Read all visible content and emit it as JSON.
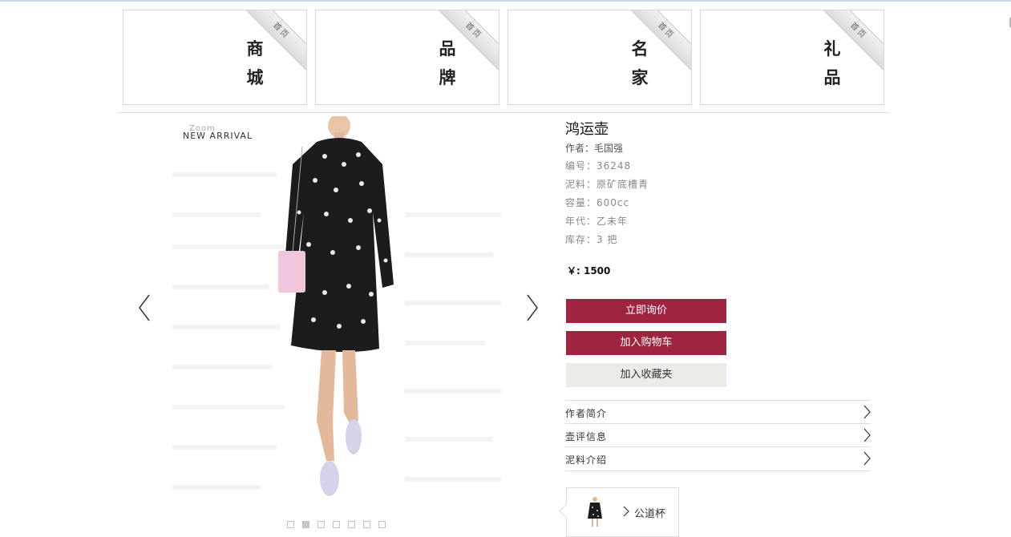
{
  "categories": [
    {
      "line1": "商",
      "line2": "城",
      "ribbon": "首页"
    },
    {
      "line1": "品",
      "line2": "牌",
      "ribbon": "首页"
    },
    {
      "line1": "名",
      "line2": "家",
      "ribbon": "首页"
    },
    {
      "line1": "礼",
      "line2": "品",
      "ribbon": "首页"
    }
  ],
  "gallery": {
    "zoom_text": "Zoom",
    "new_arrival": "NEW ARRIVAL",
    "slide_count": 7,
    "active_slide": 2,
    "prev_icon": "chevron-left-icon",
    "next_icon": "chevron-right-icon"
  },
  "product": {
    "title": "鸿运壶",
    "author": "作者：毛国强",
    "code": "编号：36248",
    "clay": "泥料：原矿底槽青",
    "capacity": "容量：600cc",
    "era": "年代：乙未年",
    "stock": "库存：3 把",
    "price": "￥: 1500"
  },
  "actions": {
    "inquire": "立即询价",
    "add_cart": "加入购物车",
    "add_fav": "加入收藏夹"
  },
  "accordion": [
    {
      "label": "作者简介"
    },
    {
      "label": "壶评信息"
    },
    {
      "label": "泥料介绍"
    }
  ],
  "related": {
    "name": "公道杯"
  },
  "colors": {
    "primary": "#9e2440",
    "secondary": "#ecebe8"
  }
}
